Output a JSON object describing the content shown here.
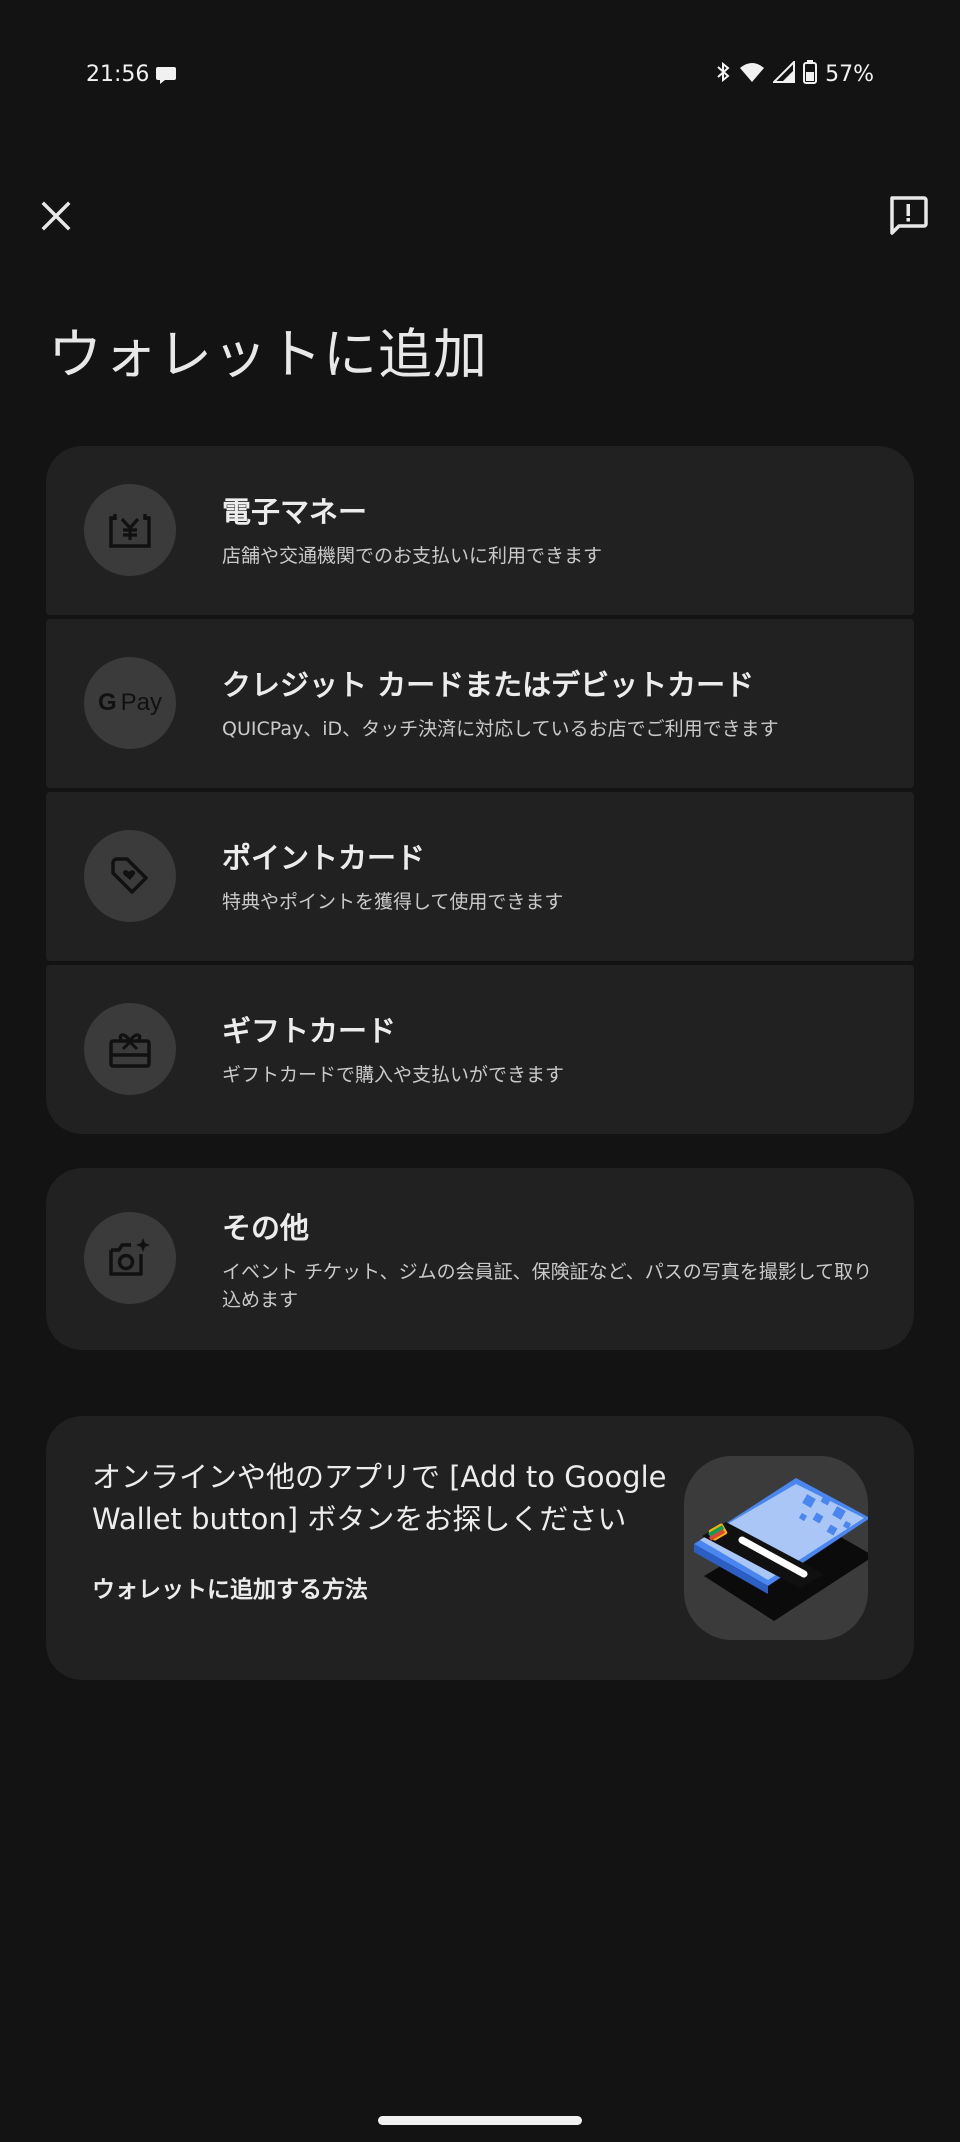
{
  "status_bar": {
    "time": "21:56",
    "battery": "57%"
  },
  "page": {
    "title": "ウォレットに追加"
  },
  "options": [
    {
      "title": "電子マネー",
      "description": "店舗や交通機関でのお支払いに利用できます",
      "icon": "yen-card-icon"
    },
    {
      "title": "クレジット カードまたはデビットカード",
      "description": "QUICPay、iD、タッチ決済に対応しているお店でご利用できます",
      "icon": "gpay-icon",
      "icon_label": "Pay",
      "icon_g": "G"
    },
    {
      "title": "ポイントカード",
      "description": "特典やポイントを獲得して使用できます",
      "icon": "loyalty-tag-icon"
    },
    {
      "title": "ギフトカード",
      "description": "ギフトカードで購入や支払いができます",
      "icon": "gift-card-icon"
    }
  ],
  "other": {
    "title": "その他",
    "description": "イベント チケット、ジムの会員証、保険証など、パスの写真を撮影して取り込めます",
    "icon": "camera-sparkle-icon"
  },
  "promo": {
    "title": "オンラインや他のアプリで [Add to Google Wallet button] ボタンをお探しください",
    "link": "ウォレットに追加する方法"
  },
  "colors": {
    "background": "#131313",
    "card": "#212121",
    "icon_circle": "#3b3b3b",
    "accent_blue": "#4a86f0"
  }
}
